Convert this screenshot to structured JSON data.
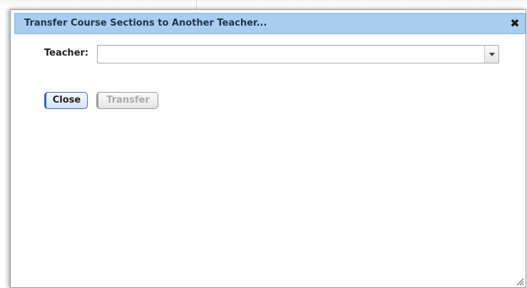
{
  "dialog": {
    "title": "Transfer Course Sections to Another Teacher...",
    "close_icon": "close-x-icon"
  },
  "form": {
    "teacher_label": "Teacher:",
    "teacher_value": "",
    "dropdown_icon": "chevron-down-icon"
  },
  "buttons": {
    "close_label": "Close",
    "transfer_label": "Transfer",
    "transfer_enabled": false
  },
  "colors": {
    "titlebar": "#a9cdee",
    "title_text": "#1f3550",
    "primary_border": "#2f66b3",
    "disabled_text": "#aaaaaa"
  }
}
